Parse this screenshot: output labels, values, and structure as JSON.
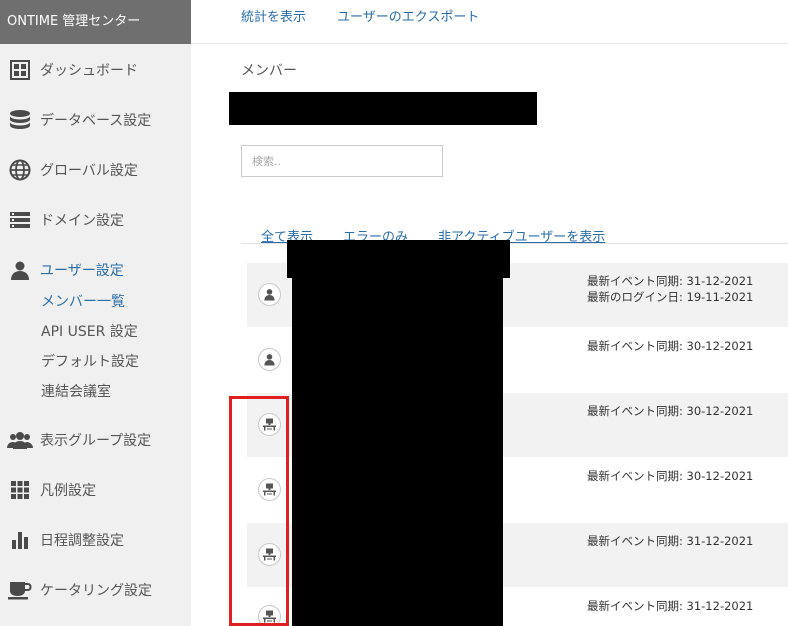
{
  "app": {
    "title": "ONTIME 管理センター"
  },
  "sidebar": {
    "items": [
      {
        "label": "ダッシュボード",
        "icon": "dashboard-icon"
      },
      {
        "label": "データベース設定",
        "icon": "database-icon"
      },
      {
        "label": "グローバル設定",
        "icon": "globe-icon"
      },
      {
        "label": "ドメイン設定",
        "icon": "server-list-icon"
      },
      {
        "label": "ユーザー設定",
        "icon": "user-icon",
        "active": true
      },
      {
        "label": "表示グループ設定",
        "icon": "group-icon"
      },
      {
        "label": "凡例設定",
        "icon": "grid-icon"
      },
      {
        "label": "日程調整設定",
        "icon": "bar-chart-icon"
      },
      {
        "label": "ケータリング設定",
        "icon": "coffee-cup-icon"
      }
    ],
    "subitems": [
      {
        "label": "メンバー一覧",
        "active": true
      },
      {
        "label": "API USER 設定"
      },
      {
        "label": "デフォルト設定"
      },
      {
        "label": "連結会議室"
      }
    ]
  },
  "topbar": {
    "links": [
      "統計を表示",
      "ユーザーのエクスポート"
    ]
  },
  "main": {
    "title": "メンバー",
    "search_placeholder": "検索..",
    "filters": [
      "全て表示",
      "エラーのみ",
      "非アクティブユーザーを表示"
    ],
    "rows": [
      {
        "type": "person",
        "icon": "person-icon",
        "lines": [
          "最新イベント同期: 31-12-2021",
          "最新のログイン日: 19-11-2021"
        ]
      },
      {
        "type": "person",
        "icon": "person-icon",
        "lines": [
          "最新イベント同期: 30-12-2021"
        ]
      },
      {
        "type": "room",
        "icon": "room-resource-icon",
        "lines": [
          "最新イベント同期: 30-12-2021"
        ]
      },
      {
        "type": "room",
        "icon": "room-resource-icon",
        "lines": [
          "最新イベント同期: 30-12-2021"
        ]
      },
      {
        "type": "room",
        "icon": "room-resource-icon",
        "lines": [
          "最新イベント同期: 31-12-2021"
        ]
      },
      {
        "type": "room",
        "icon": "room-resource-icon",
        "lines": [
          "最新イベント同期: 31-12-2021"
        ]
      }
    ]
  },
  "colors": {
    "link": "#2a6ea8",
    "sidebar_header": "#6f6f6f",
    "sidebar_bg": "#f0f0f0",
    "highlight": "#e02020",
    "redaction": "#000000"
  }
}
